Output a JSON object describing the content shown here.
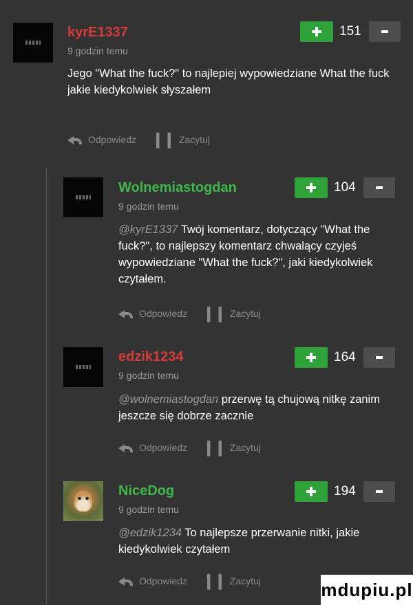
{
  "colors": {
    "background": "#333333",
    "upvote": "#2fa33a",
    "downvote": "#4d4d4d",
    "muted_text": "#9a9a9a"
  },
  "labels": {
    "reply": "Odpowiedz",
    "quote": "Zacytuj"
  },
  "comments": [
    {
      "username": "kyrE1337",
      "username_color": "#d63a3a",
      "time": "9 godzin temu",
      "mention": "",
      "text": "Jego \"What the fuck?\" to najlepiej wypowiedziane What the fuck jakie kiedykolwiek słyszałem",
      "score": "151",
      "avatar_icon": "dark-avatar-icon"
    },
    {
      "username": "Wolnemiastogdan",
      "username_color": "#3fb848",
      "time": "9 godzin temu",
      "mention": "@kyrE1337",
      "text": "Twój komentarz, dotyczący \"What the fuck?\", to najlepszy komentarz chwalący czyjeś wypowiedziane \"What the fuck?\", jaki kiedykolwiek czytałem.",
      "score": "104",
      "avatar_icon": "dark-avatar-icon"
    },
    {
      "username": "edzik1234",
      "username_color": "#d63a3a",
      "time": "9 godzin temu",
      "mention": "@wolnemiastogdan",
      "text": "przerwę tą chujową nitkę zanim jeszcze się dobrze zacznie",
      "score": "164",
      "avatar_icon": "dark-avatar-icon"
    },
    {
      "username": "NiceDog",
      "username_color": "#3fb848",
      "time": "9 godzin temu",
      "mention": "@edzik1234",
      "text": "To najlepsze przerwanie nitki, jakie kiedykolwiek czytałem",
      "score": "194",
      "avatar_icon": "cheetah-avatar-icon"
    }
  ],
  "watermark": "mdupiu.pl"
}
